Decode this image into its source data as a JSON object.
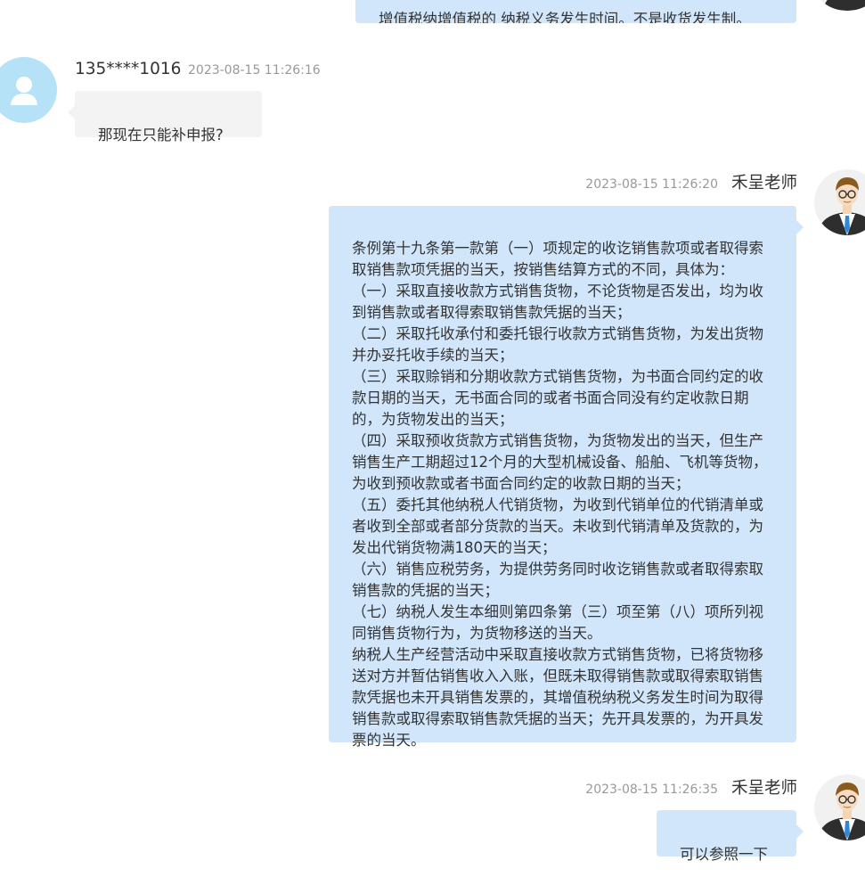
{
  "messages": [
    {
      "side": "right",
      "text": "增值税纳增值税的 纳税义务发生时间。不是收货发生制。"
    },
    {
      "side": "left",
      "sender": "135****1016",
      "time": "2023-08-15 11:26:16",
      "text": "那现在只能补申报?"
    },
    {
      "side": "right",
      "sender": "禾呈老师",
      "time": "2023-08-15 11:26:20",
      "text": "条例第十九条第一款第（一）项规定的收讫销售款项或者取得索取销售款项凭据的当天，按销售结算方式的不同，具体为：\n（一）采取直接收款方式销售货物，不论货物是否发出，均为收到销售款或者取得索取销售款凭据的当天；\n（二）采取托收承付和委托银行收款方式销售货物，为发出货物并办妥托收手续的当天；\n（三）采取赊销和分期收款方式销售货物，为书面合同约定的收款日期的当天，无书面合同的或者书面合同没有约定收款日期的，为货物发出的当天；\n（四）采取预收货款方式销售货物，为货物发出的当天，但生产销售生产工期超过12个月的大型机械设备、船舶、飞机等货物，为收到预收款或者书面合同约定的收款日期的当天；\n（五）委托其他纳税人代销货物，为收到代销单位的代销清单或者收到全部或者部分货款的当天。未收到代销清单及货款的，为发出代销货物满180天的当天；\n（六）销售应税劳务，为提供劳务同时收讫销售款或者取得索取销售款的凭据的当天；\n（七）纳税人发生本细则第四条第（三）项至第（八）项所列视同销售货物行为，为货物移送的当天。\n纳税人生产经营活动中采取直接收款方式销售货物，已将货物移送对方并暂估销售收入入账，但既未取得销售款或取得索取销售款凭据也未开具销售发票的，其增值税纳税义务发生时间为取得销售款或取得索取销售款凭据的当天；先开具发票的，为开具发票的当天。"
    },
    {
      "side": "right",
      "sender": "禾呈老师",
      "time": "2023-08-15 11:26:35",
      "text": "可以参照一下"
    }
  ],
  "icons": {
    "user_avatar": "user-silhouette-icon",
    "teacher_avatar": "teacher-portrait-icon"
  },
  "colors": {
    "right_bubble": "#d1e6fb",
    "left_bubble": "#f3f3f3",
    "user_avatar_bg": "#b6e2f8"
  }
}
